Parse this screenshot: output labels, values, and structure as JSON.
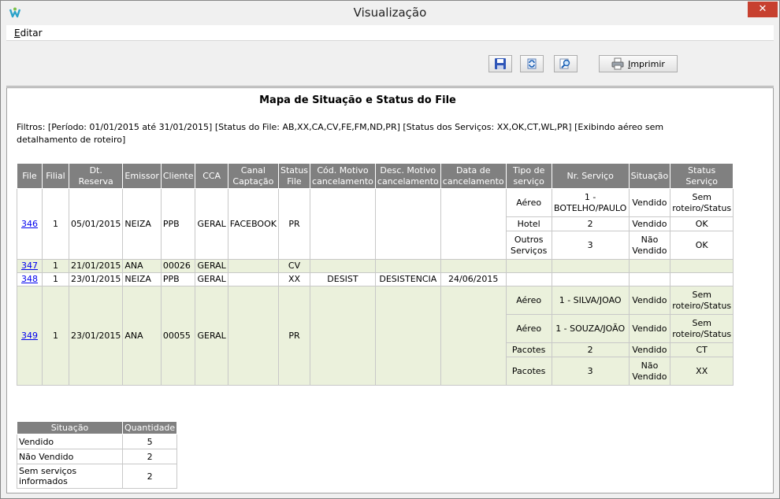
{
  "window": {
    "title": "Visualização",
    "close_label": "✕"
  },
  "menu": {
    "editar": "Editar"
  },
  "toolbar": {
    "print_label": "Imprimir"
  },
  "report": {
    "title": "Mapa de Situação e Status do File",
    "filters": "Filtros: [Período: 01/01/2015 até 31/01/2015] [Status do File: AB,XX,CA,CV,FE,FM,ND,PR] [Status dos Serviços: XX,OK,CT,WL,PR] [Exibindo aéreo sem detalhamento de roteiro]"
  },
  "grid": {
    "headers": [
      "File",
      "Filial",
      "Dt. Reserva",
      "Emissor",
      "Cliente",
      "CCA",
      "Canal Captação",
      "Status File",
      "Cód. Motivo cancelamento",
      "Desc. Motivo cancelamento",
      "Data de cancelamento",
      "Tipo de serviço",
      "Nr. Serviço",
      "Situação",
      "Status Serviço"
    ],
    "files": [
      {
        "file": "346",
        "filial": "1",
        "dt_reserva": "05/01/2015",
        "emissor": "NEIZA",
        "cliente": "PPB",
        "cca": "GERAL",
        "canal": "FACEBOOK",
        "status": "PR",
        "cod_motivo": "",
        "desc_motivo": "",
        "data_canc": "",
        "services": [
          {
            "tipo": "Aéreo",
            "nr": "1 - BOTELHO/PAULO",
            "situacao": "Vendido",
            "status": "Sem roteiro/Status"
          },
          {
            "tipo": "Hotel",
            "nr": "2",
            "situacao": "Vendido",
            "status": "OK"
          },
          {
            "tipo": "Outros Serviços",
            "nr": "3",
            "situacao": "Não Vendido",
            "status": "OK"
          }
        ]
      },
      {
        "file": "347",
        "filial": "1",
        "dt_reserva": "21/01/2015",
        "emissor": "ANA",
        "cliente": "00026",
        "cca": "GERAL",
        "canal": "",
        "status": "CV",
        "cod_motivo": "",
        "desc_motivo": "",
        "data_canc": ""
      },
      {
        "file": "348",
        "filial": "1",
        "dt_reserva": "23/01/2015",
        "emissor": "NEIZA",
        "cliente": "PPB",
        "cca": "GERAL",
        "canal": "",
        "status": "XX",
        "cod_motivo": "DESIST",
        "desc_motivo": "DESISTENCIA",
        "data_canc": "24/06/2015"
      },
      {
        "file": "349",
        "filial": "1",
        "dt_reserva": "23/01/2015",
        "emissor": "ANA",
        "cliente": "00055",
        "cca": "GERAL",
        "canal": "",
        "status": "PR",
        "cod_motivo": "",
        "desc_motivo": "",
        "data_canc": "",
        "services": [
          {
            "tipo": "Aéreo",
            "nr": "1 - SILVA/JOAO",
            "situacao": "Vendido",
            "status": "Sem roteiro/Status"
          },
          {
            "tipo": "Aéreo",
            "nr": "1 - SOUZA/JOÃO",
            "situacao": "Vendido",
            "status": "Sem roteiro/Status"
          },
          {
            "tipo": "Pacotes",
            "nr": "2",
            "situacao": "Vendido",
            "status": "CT"
          },
          {
            "tipo": "Pacotes",
            "nr": "3",
            "situacao": "Não Vendido",
            "status": "XX"
          }
        ]
      }
    ]
  },
  "summary": {
    "headers": [
      "Situação",
      "Quantidade"
    ],
    "rows": [
      {
        "label": "Vendido",
        "qty": "5"
      },
      {
        "label": "Não Vendido",
        "qty": "2"
      },
      {
        "label": "Sem serviços informados",
        "qty": "2"
      }
    ]
  }
}
